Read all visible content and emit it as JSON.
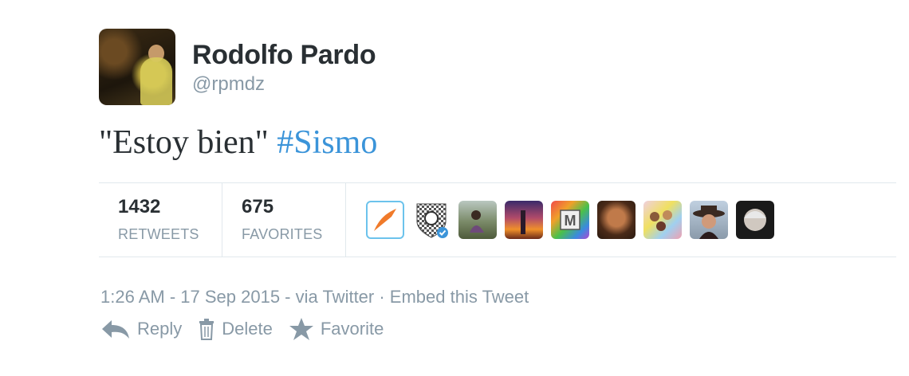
{
  "tweet": {
    "author_name": "Rodolfo Pardo",
    "author_handle": "@rpmdz",
    "text_plain": "\"Estoy bien\" ",
    "hashtag": "#Sismo"
  },
  "stats": {
    "retweets_count": "1432",
    "retweets_label": "RETWEETS",
    "favorites_count": "675",
    "favorites_label": "FAVORITES"
  },
  "facepile": [
    {
      "icon": "orange-arrow-avatar"
    },
    {
      "icon": "shield-verified-avatar"
    },
    {
      "icon": "girl-field-avatar"
    },
    {
      "icon": "sunset-avatar"
    },
    {
      "icon": "m-logo-avatar"
    },
    {
      "icon": "woman-portrait-avatar"
    },
    {
      "icon": "group-photo-avatar"
    },
    {
      "icon": "hat-woman-avatar"
    },
    {
      "icon": "man-portrait-avatar"
    }
  ],
  "meta": {
    "time": "1:26 AM - 17 Sep 2015",
    "via": " - via Twitter",
    "embed": " · Embed this Tweet"
  },
  "actions": {
    "reply_label": "Reply",
    "delete_label": "Delete",
    "favorite_label": "Favorite"
  },
  "colors": {
    "hashtag": "#3b94d9",
    "muted": "#8899a6",
    "text": "#292f33"
  }
}
